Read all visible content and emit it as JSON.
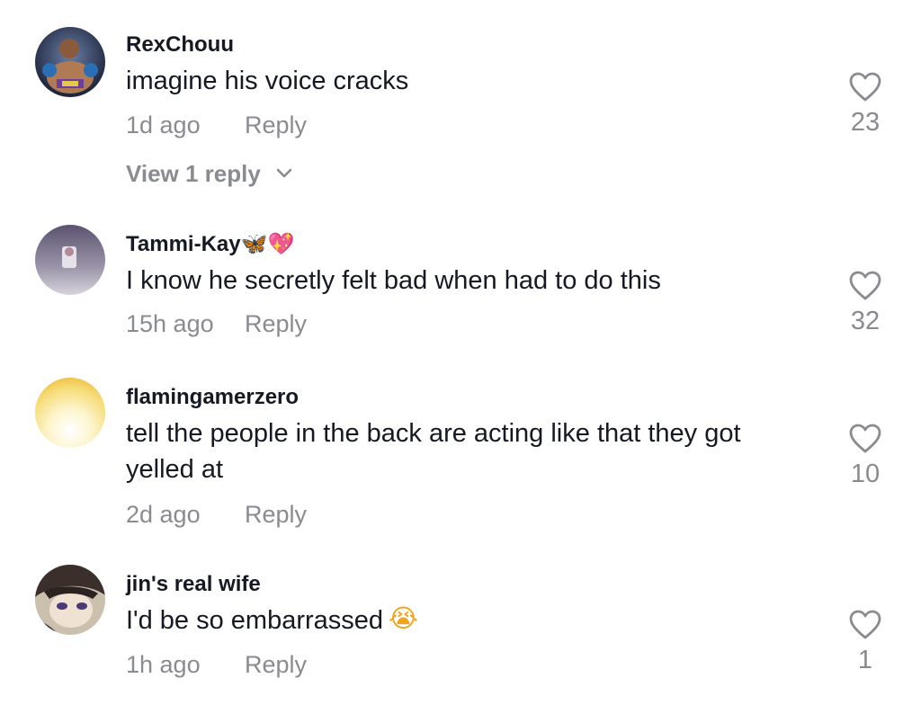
{
  "comments": [
    {
      "username": "RexChouu",
      "username_emoji": "",
      "text": "imagine his voice cracks",
      "text_emoji": "",
      "time": "1d ago",
      "reply_label": "Reply",
      "likes": "23",
      "view_replies": "View 1 reply",
      "avatar_icon": "boxer-avatar"
    },
    {
      "username": "Tammi-Kay",
      "username_emoji": "🦋💖",
      "text": "I know he secretly felt bad when had to do this",
      "text_emoji": "",
      "time": "15h ago",
      "reply_label": "Reply",
      "likes": "32",
      "avatar_icon": "photo-avatar"
    },
    {
      "username": "flamingamerzero",
      "username_emoji": "",
      "text": "tell the people in the back are acting like that they got yelled at",
      "text_emoji": "",
      "time": "2d ago",
      "reply_label": "Reply",
      "likes": "10",
      "avatar_icon": "sunset-avatar"
    },
    {
      "username": "jin's real wife",
      "username_emoji": "",
      "text": "I'd be so embarrassed",
      "text_emoji": "😭",
      "time": "1h ago",
      "reply_label": "Reply",
      "likes": "1",
      "avatar_icon": "anime-avatar"
    }
  ],
  "colors": {
    "text_primary": "#161823",
    "text_secondary": "#8a8b91",
    "background": "#ffffff"
  }
}
